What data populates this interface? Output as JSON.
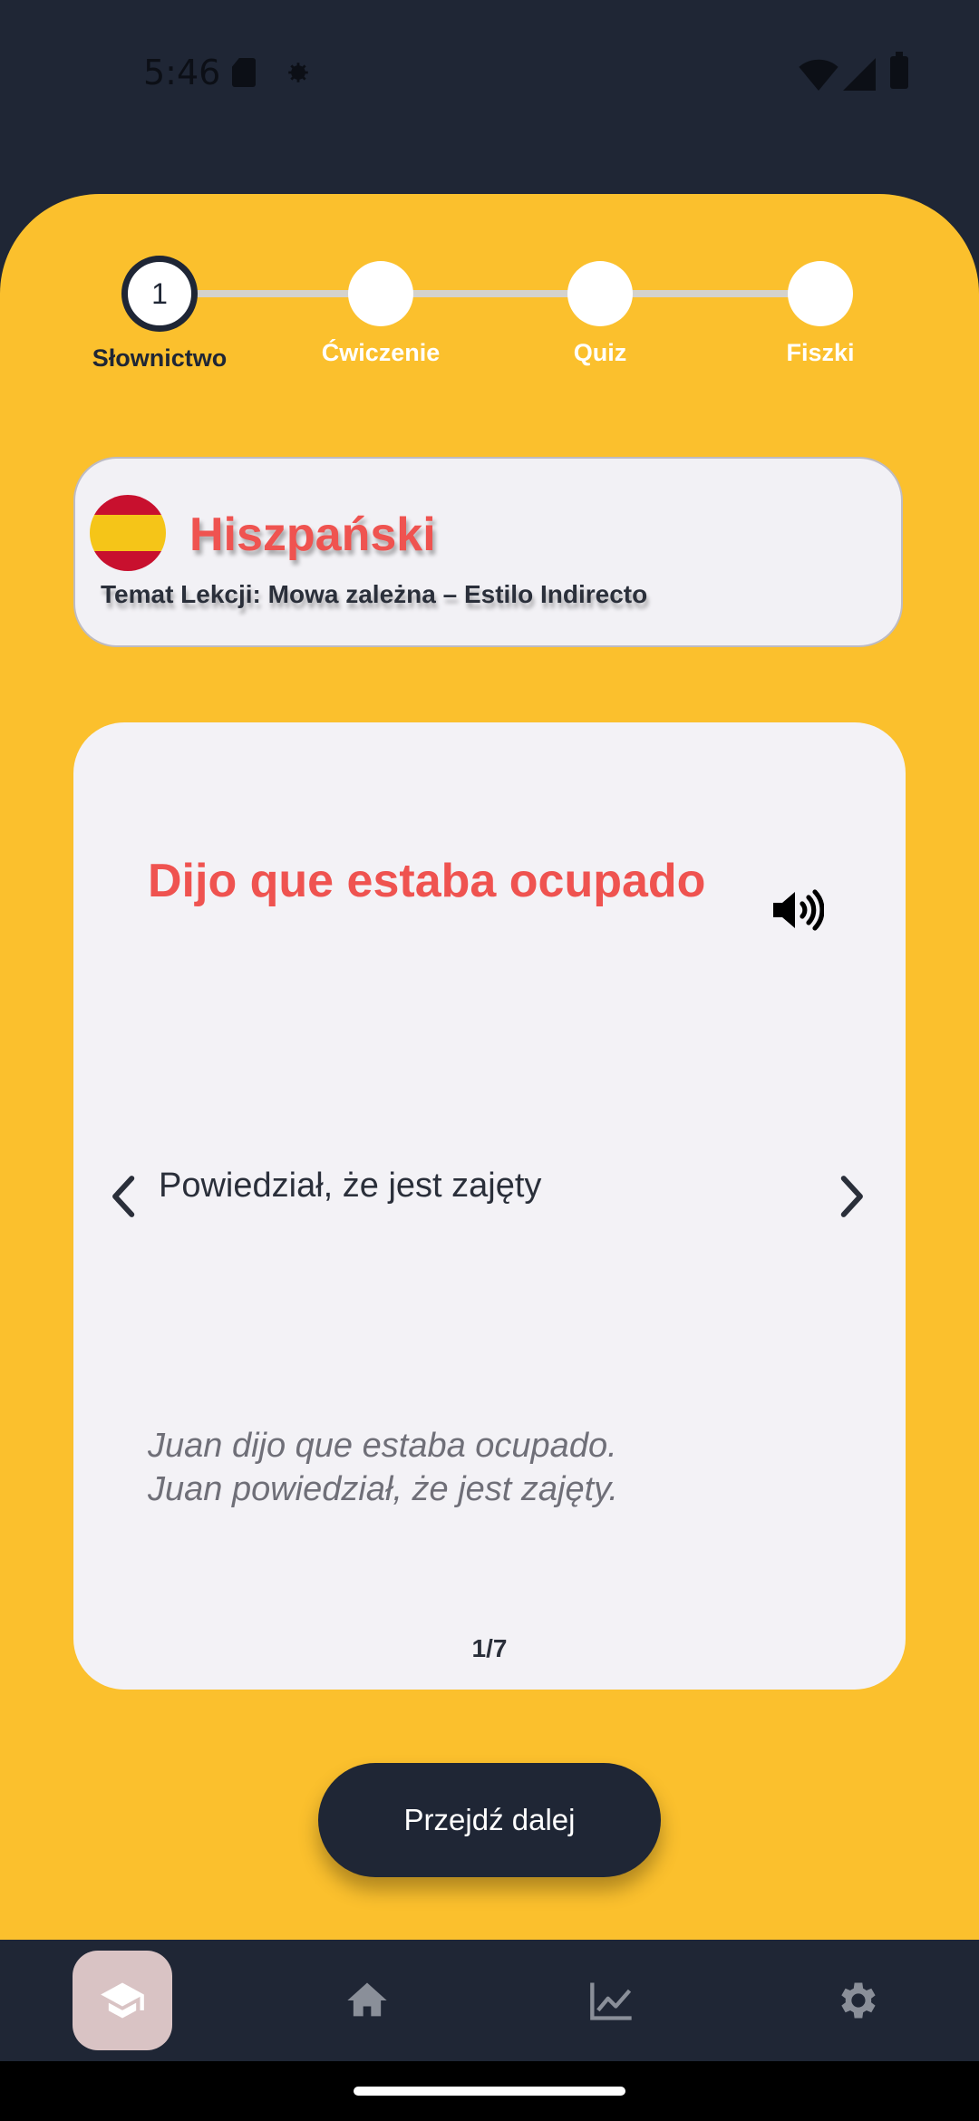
{
  "status_bar": {
    "time": "5:46"
  },
  "stepper": {
    "steps": [
      {
        "number": "1",
        "label": "Słownictwo"
      },
      {
        "label": "Ćwiczenie"
      },
      {
        "label": "Quiz"
      },
      {
        "label": "Fiszki"
      }
    ],
    "active_step_index": 0
  },
  "language_card": {
    "language": "Hiszpański",
    "topic": "Temat Lekcji: Mowa zależna – Estilo Indirecto"
  },
  "flashcard": {
    "word": "Dijo que estaba ocupado",
    "translation": "Powiedział, że jest zajęty",
    "example_line_1": "Juan dijo que estaba ocupado.",
    "example_line_2": "Juan powiedział, że jest zajęty.",
    "counter": "1/7"
  },
  "continue_button": {
    "label": "Przejdź dalej"
  },
  "bottom_nav": {
    "items": [
      {
        "icon": "graduation-cap-icon",
        "active": true
      },
      {
        "icon": "home-icon",
        "active": false
      },
      {
        "icon": "chart-line-icon",
        "active": false
      },
      {
        "icon": "gear-icon",
        "active": false
      }
    ]
  },
  "colors": {
    "panel": "#fbc02d",
    "dark": "#1f2635",
    "accent_red": "#ef5350",
    "card": "#f3f2f6"
  }
}
